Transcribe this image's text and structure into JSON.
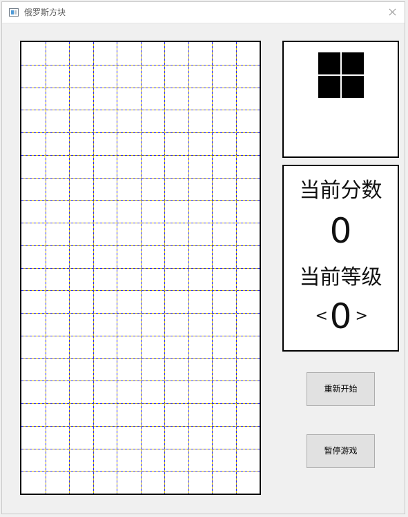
{
  "window": {
    "title": "俄罗斯方块"
  },
  "board": {
    "columns": 10,
    "rows": 20,
    "grid_colors": [
      "#2b2bff",
      "#d6c400"
    ]
  },
  "next_piece": {
    "shape": "O",
    "color": "#000000"
  },
  "score_panel": {
    "score_label": "当前分数",
    "score_value": "0",
    "level_label": "当前等级",
    "level_value": "0",
    "level_decrease_label": "<",
    "level_increase_label": ">"
  },
  "buttons": {
    "restart_label": "重新开始",
    "pause_label": "暂停游戏"
  }
}
